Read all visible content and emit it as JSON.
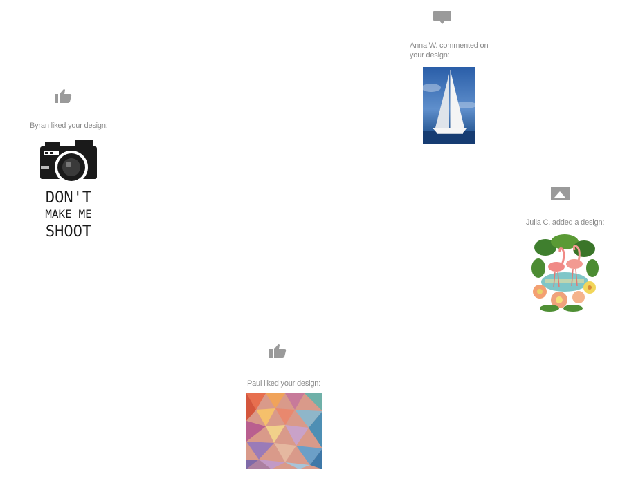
{
  "feed": {
    "items": [
      {
        "user": "Anna W.",
        "action": "commented on",
        "text": "Anna W. commented on your design:",
        "icon": "comment-icon",
        "design": "sailboat-design"
      },
      {
        "user": "Byran",
        "action": "liked",
        "text": "Byran liked your design:",
        "icon": "thumbs-up-icon",
        "design": "camera-design",
        "design_text": [
          "DON'T",
          "MAKE ME",
          "SHOOT"
        ]
      },
      {
        "user": "Julia C.",
        "action": "added",
        "text": "Julia C. added a design:",
        "icon": "image-icon",
        "design": "flamingo-design"
      },
      {
        "user": "Paul",
        "action": "liked",
        "text": "Paul liked your design:",
        "icon": "thumbs-up-icon",
        "design": "geometric-pattern-design"
      }
    ]
  },
  "colors": {
    "icon": "#9a9a9a",
    "caption": "#8a8a8a"
  }
}
